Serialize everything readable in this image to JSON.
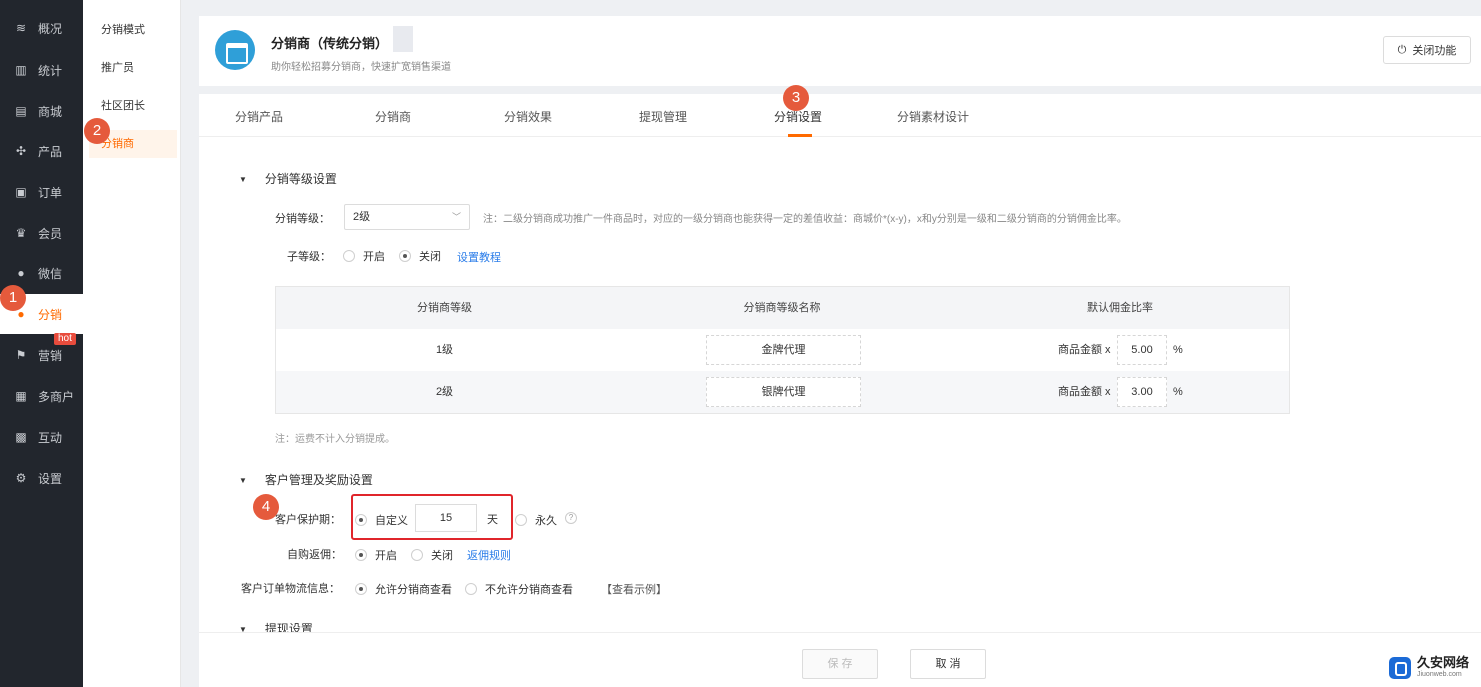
{
  "nav": {
    "items": [
      {
        "label": "概况",
        "icon": "layers-icon"
      },
      {
        "label": "统计",
        "icon": "chart-icon"
      },
      {
        "label": "商城",
        "icon": "store-icon"
      },
      {
        "label": "产品",
        "icon": "grid-icon"
      },
      {
        "label": "订单",
        "icon": "order-icon"
      },
      {
        "label": "会员",
        "icon": "crown-icon"
      },
      {
        "label": "微信",
        "icon": "wechat-icon"
      },
      {
        "label": "分销",
        "icon": "user-icon"
      },
      {
        "label": "营销",
        "icon": "flag-icon"
      },
      {
        "label": "多商户",
        "icon": "shop-icon"
      },
      {
        "label": "互动",
        "icon": "apps-icon"
      },
      {
        "label": "设置",
        "icon": "gear-icon"
      }
    ],
    "hot_badge": "hot"
  },
  "subnav": {
    "items": [
      "分销模式",
      "推广员",
      "社区团长",
      "分销商"
    ]
  },
  "header": {
    "title": "分销商（传统分销）",
    "subtitle": "助你轻松招募分销商，快速扩宽销售渠道",
    "close_label": "关闭功能"
  },
  "tabs": [
    "分销产品",
    "分销商",
    "分销效果",
    "提现管理",
    "分销设置",
    "分销素材设计"
  ],
  "level_section": {
    "title": "分销等级设置",
    "level_label": "分销等级：",
    "level_value": "2级",
    "note": "注：二级分销商成功推广一件商品时，对应的一级分销商也能获得一定的差值收益：商城价*(x-y)，x和y分别是一级和二级分销商的分销佣金比率。",
    "sublevel_label": "子等级：",
    "sublevel_on": "开启",
    "sublevel_off": "关闭",
    "tutorial_link": "设置教程"
  },
  "table": {
    "headers": [
      "分销商等级",
      "分销商等级名称",
      "默认佣金比率"
    ],
    "rows": [
      {
        "level": "1级",
        "name": "金牌代理",
        "rate_label": "商品金额 x",
        "rate": "5.00",
        "unit": "%"
      },
      {
        "level": "2级",
        "name": "银牌代理",
        "rate_label": "商品金额 x",
        "rate": "3.00",
        "unit": "%"
      }
    ],
    "footnote": "注：运费不计入分销提成。"
  },
  "customer_section": {
    "title": "客户管理及奖励设置",
    "protect_label": "客户保护期：",
    "custom": "自定义",
    "days": "15",
    "day_unit": "天",
    "forever": "永久",
    "help": "?",
    "selfbuy_label": "自购返佣：",
    "selfbuy_on": "开启",
    "selfbuy_off": "关闭",
    "rebate_link": "返佣规则",
    "logistics_label": "客户订单物流信息：",
    "allow": "允许分销商查看",
    "deny": "不允许分销商查看",
    "example_link": "【查看示例】"
  },
  "withdraw_section": {
    "title": "提现设置"
  },
  "footer": {
    "save": "保 存",
    "cancel": "取 消"
  },
  "steps": [
    "1",
    "2",
    "3",
    "4"
  ],
  "watermark": {
    "cn": "久安网络",
    "en": "Jiuonweb.com"
  },
  "colors": {
    "accent": "#ff6a00",
    "badge": "#e55a3c",
    "highlight": "#e0252b",
    "link": "#2b7de9",
    "nav_bg": "#22262d"
  }
}
